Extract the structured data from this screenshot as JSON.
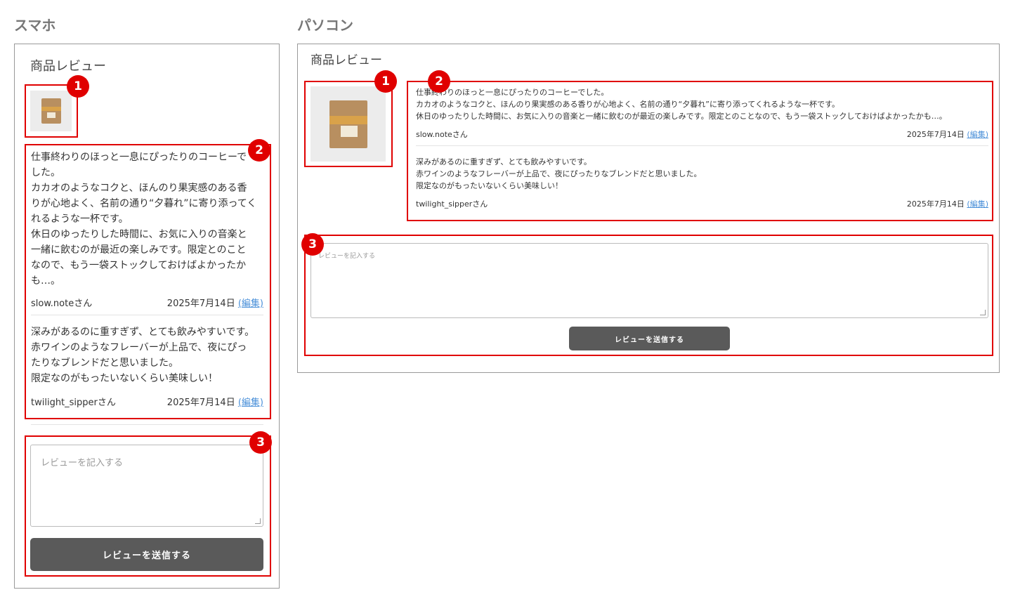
{
  "labels": {
    "mobile": "スマホ",
    "pc": "パソコン"
  },
  "section_title": "商品レビュー",
  "badges": [
    "1",
    "2",
    "3"
  ],
  "mobile": {
    "review1_text": "仕事終わりのほっと一息にぴったりのコーヒーで\nした。\nカカオのようなコクと、ほんのり果実感のある香\nりが心地よく、名前の通り“夕暮れ”に寄り添ってく\nれるような一杯です。\n休日のゆったりした時間に、お気に入りの音楽と\n一緒に飲むのが最近の楽しみです。限定とのこと\nなので、もう一袋ストックしておけばよかったか\nも…。",
    "review2_text": "深みがあるのに重すぎず、とても飲みやすいです。\n赤ワインのようなフレーバーが上品で、夜にぴっ\nたりなブレンドだと思いました。\n限定なのがもったいないくらい美味しい！"
  },
  "pc": {
    "review1_text": "仕事終わりのほっと一息にぴったりのコーヒーでした。\nカカオのようなコクと、ほんのり果実感のある香りが心地よく、名前の通り“夕暮れ”に寄り添ってくれるような一杯です。\n休日のゆったりした時間に、お気に入りの音楽と一緒に飲むのが最近の楽しみです。限定とのことなので、もう一袋ストックしておけばよかったかも…。",
    "review2_text": "深みがあるのに重すぎず、とても飲みやすいです。\n赤ワインのようなフレーバーが上品で、夜にぴったりなブレンドだと思いました。\n限定なのがもったいないくらい美味しい！"
  },
  "reviews": [
    {
      "author": "slow.noteさん",
      "date": "2025年7月14日",
      "edit": "(編集)"
    },
    {
      "author": "twilight_sipperさん",
      "date": "2025年7月14日",
      "edit": "(編集)"
    }
  ],
  "form": {
    "placeholder": "レビューを記入する",
    "submit_label": "レビューを送信する"
  },
  "colors": {
    "highlight": "#e00000",
    "button": "#5a5a5a",
    "link": "#4a90d9"
  },
  "icons": {
    "product": "coffee-bag-thumbnail"
  }
}
